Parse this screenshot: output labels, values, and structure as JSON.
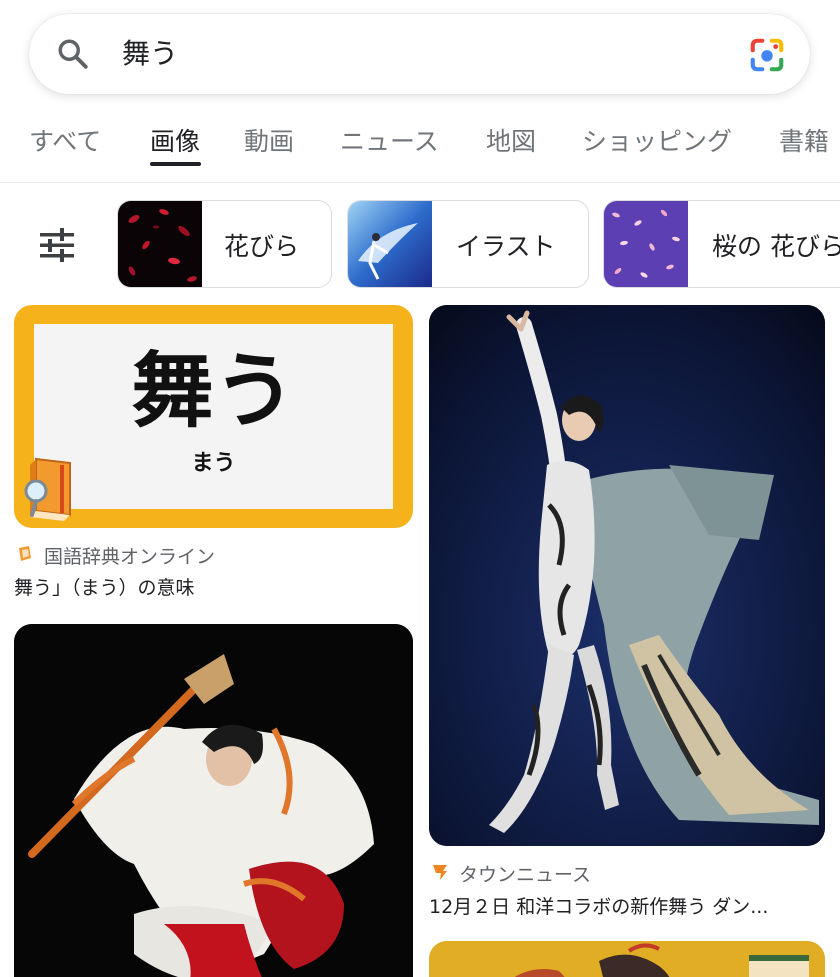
{
  "search": {
    "query": "舞う"
  },
  "tabs": [
    {
      "label": "すべて"
    },
    {
      "label": "画像"
    },
    {
      "label": "動画"
    },
    {
      "label": "ニュース"
    },
    {
      "label": "地図"
    },
    {
      "label": "ショッピング"
    },
    {
      "label": "書籍"
    }
  ],
  "active_tab": "画像",
  "chips": [
    {
      "label": "花びら"
    },
    {
      "label": "イラスト"
    },
    {
      "label": "桜の 花びら"
    }
  ],
  "results": [
    {
      "image_title": "舞う",
      "image_reading": "まう",
      "source": "国語辞典オンライン",
      "caption": "舞う」（まう）の意味"
    },
    {
      "source": "タウンニュース",
      "caption": "12月２日 和洋コラボの新作舞う ダン..."
    },
    {},
    {}
  ],
  "colors": {
    "accent_border": "#f6b21a",
    "town_news_orange": "#f0841e"
  }
}
